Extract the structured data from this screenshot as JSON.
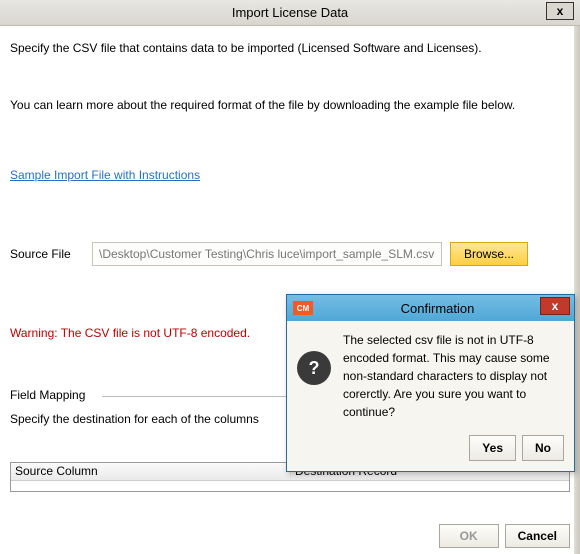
{
  "window": {
    "title": "Import License Data",
    "close_glyph": "x"
  },
  "intro": {
    "line1": "Specify the CSV file that contains data to be imported (Licensed Software and Licenses).",
    "line2": "You can learn more about the required format of the file by downloading the example file below."
  },
  "sample_link": "Sample Import File with Instructions",
  "source": {
    "label": "Source File",
    "path": "\\Desktop\\Customer Testing\\Chris luce\\import_sample_SLM.csv",
    "browse": "Browse..."
  },
  "warning": "Warning: The CSV file is not UTF-8 encoded.",
  "field_mapping": {
    "legend": "Field Mapping",
    "desc": "Specify the destination for each of the columns",
    "headers": {
      "col1": "Source Column",
      "col2": "Destination Record"
    }
  },
  "footer": {
    "ok": "OK",
    "cancel": "Cancel"
  },
  "confirm": {
    "badge": "CM",
    "title": "Confirmation",
    "close_glyph": "x",
    "message": "The selected csv file is not in UTF-8 encoded format. This may cause some non-standard characters to display not corerctly. Are you sure you want to continue?",
    "yes": "Yes",
    "no": "No",
    "icon_glyph": "?"
  }
}
